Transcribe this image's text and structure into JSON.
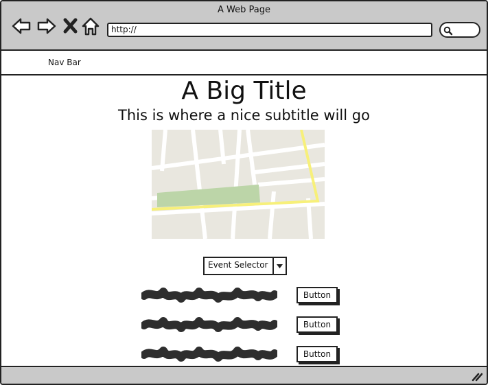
{
  "browser": {
    "window_title": "A Web Page",
    "url": "http://",
    "icons": [
      "back-arrow-icon",
      "forward-arrow-icon",
      "close-x-icon",
      "home-icon",
      "search-icon"
    ]
  },
  "nav": {
    "label": "Nav Bar"
  },
  "page": {
    "title": "A Big Title",
    "subtitle": "This is where a nice subtitle will go"
  },
  "map": {
    "icon": "map-image-placeholder",
    "colors": {
      "land": "#e9e7df",
      "road": "#ffffff",
      "park": "#bcd5a8",
      "highway": "#f7f07a"
    }
  },
  "selector": {
    "label": "Event Selector",
    "icon": "dropdown-arrow-icon"
  },
  "rows": [
    {
      "button": "Button"
    },
    {
      "button": "Button"
    },
    {
      "button": "Button"
    }
  ],
  "colors": {
    "chrome": "#c9c9c9",
    "ink": "#222222"
  }
}
